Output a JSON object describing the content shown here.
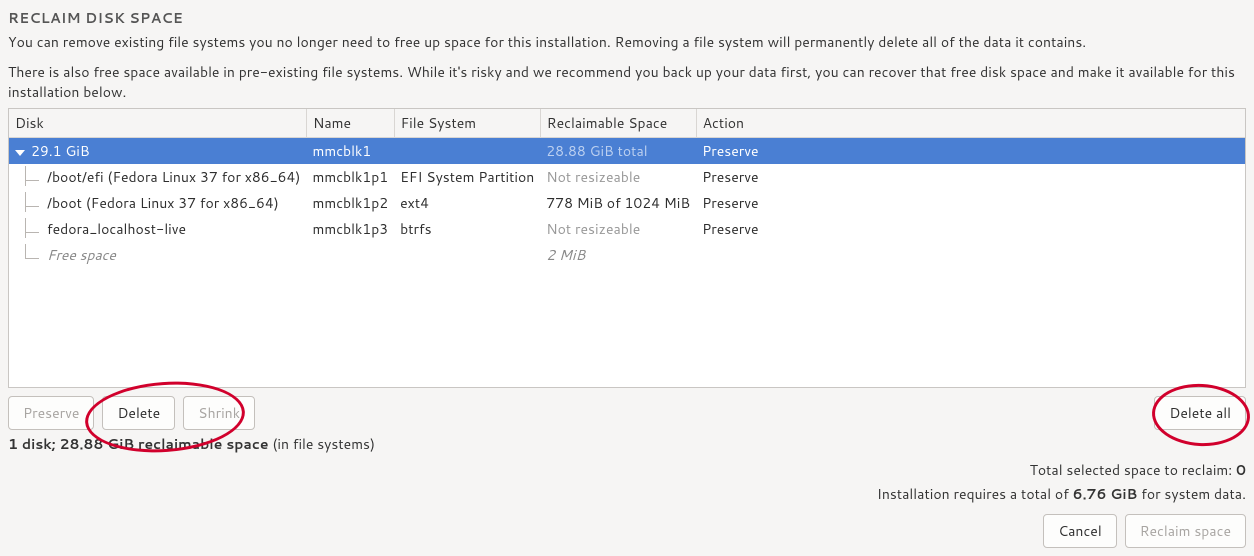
{
  "header": {
    "title": "RECLAIM DISK SPACE",
    "intro1": "You can remove existing file systems you no longer need to free up space for this installation.  Removing a file system will permanently delete all of the data it contains.",
    "intro2": "There is also free space available in pre-existing file systems.  While it's risky and we recommend you back up your data first, you can recover that free disk space and make it available for this installation below."
  },
  "columns": {
    "disk": "Disk",
    "name": "Name",
    "fs": "File System",
    "reclaimable": "Reclaimable Space",
    "action": "Action"
  },
  "rows": {
    "disk": {
      "disk": "29.1 GiB",
      "name": "mmcblk1",
      "fs": "",
      "reclaimable": "28.88 GiB total",
      "action": "Preserve"
    },
    "p1": {
      "disk": "/boot/efi (Fedora Linux 37 for x86_64)",
      "name": "mmcblk1p1",
      "fs": "EFI System Partition",
      "reclaimable": "Not resizeable",
      "action": "Preserve"
    },
    "p2": {
      "disk": "/boot (Fedora Linux 37 for x86_64)",
      "name": "mmcblk1p2",
      "fs": "ext4",
      "reclaimable": "778 MiB of 1024 MiB",
      "action": "Preserve"
    },
    "p3": {
      "disk": "fedora_localhost-live",
      "name": "mmcblk1p3",
      "fs": "btrfs",
      "reclaimable": "Not resizeable",
      "action": "Preserve"
    },
    "free": {
      "disk": "Free space",
      "reclaimable": "2 MiB"
    }
  },
  "buttons": {
    "preserve": "Preserve",
    "delete": "Delete",
    "shrink": "Shrink",
    "delete_all": "Delete all",
    "cancel": "Cancel",
    "reclaim": "Reclaim space"
  },
  "summary": {
    "bold": "1 disk; 28.88 GiB reclaimable space",
    "rest": " (in file systems)"
  },
  "totals": {
    "selected_label": "Total selected space to reclaim: ",
    "selected_value": "0",
    "requires_pre": "Installation requires a total of ",
    "requires_size": "6.76 GiB",
    "requires_post": " for system data."
  }
}
